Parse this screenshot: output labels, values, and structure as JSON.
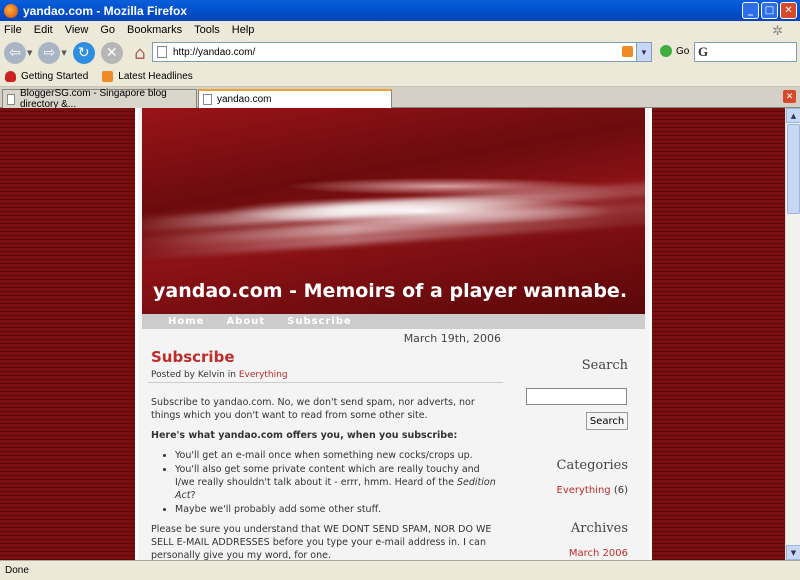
{
  "window": {
    "title": "yandao.com - Mozilla Firefox"
  },
  "menu": [
    "File",
    "Edit",
    "View",
    "Go",
    "Bookmarks",
    "Tools",
    "Help"
  ],
  "nav": {
    "url": "http://yandao.com/",
    "go_label": "Go",
    "search_placeholder": ""
  },
  "bookmarks": [
    "Getting Started",
    "Latest Headlines"
  ],
  "tabs": [
    {
      "label": "BloggerSG.com - Singapore blog directory &...",
      "active": false
    },
    {
      "label": "yandao.com",
      "active": true
    }
  ],
  "site": {
    "header_title": "yandao.com - Memoirs of a player wannabe.",
    "nav": [
      "Home",
      "About",
      "Subscribe"
    ]
  },
  "post": {
    "date": "March 19th, 2006",
    "title": "Subscribe",
    "meta_prefix": "Posted by Kelvin in",
    "meta_category": "Everything",
    "p1": "Subscribe to yandao.com. No, we don't send spam, nor adverts, nor things which you don't want to read from some other site.",
    "p2": "Here's what yandao.com offers you, when you subscribe:",
    "bullets": [
      "You'll get an e-mail once when something new cocks/crops up.",
      "You'll also get some private content which are really touchy and I/we really shouldn't talk about it - errr, hmm. Heard of the ",
      "Maybe we'll probably add some other stuff."
    ],
    "bullet2_italic": "Sedition Act",
    "bullet2_end": "?",
    "p3": "Please be sure you understand that WE DONT SEND SPAM, NOR DO WE SELL E-MAIL ADDRESSES before you type your e-mail address in. I can personally give you my word, for one."
  },
  "sidebar": {
    "search_heading": "Search",
    "search_button": "Search",
    "categories_heading": "Categories",
    "category_name": "Everything",
    "category_count": "(6)",
    "archives_heading": "Archives",
    "archive_item": "March 2006"
  },
  "status": "Done"
}
